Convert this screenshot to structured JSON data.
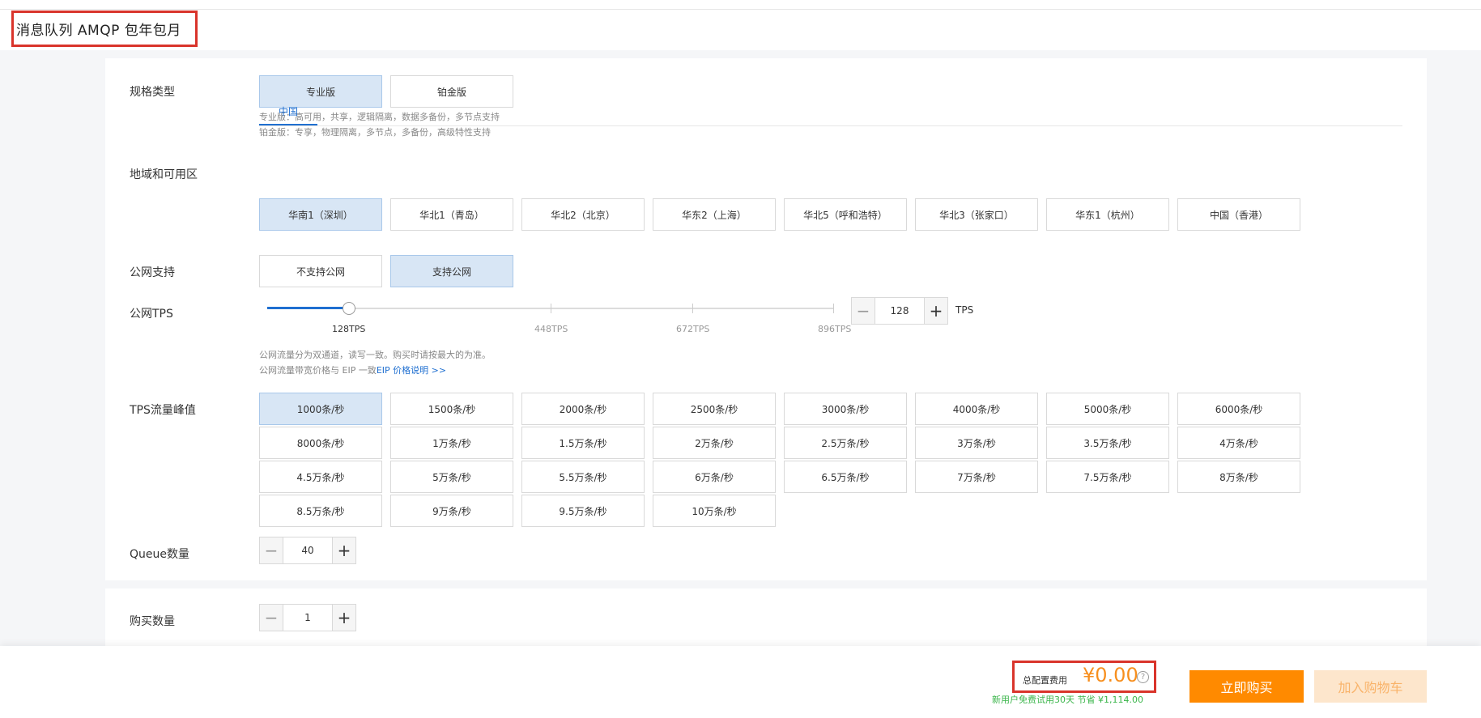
{
  "page_title": "消息队列 AMQP 包年包月",
  "spec": {
    "label": "规格类型",
    "options": [
      "专业版",
      "铂金版"
    ],
    "selected": 0,
    "hint_lines": [
      "专业版：高可用，共享，逻辑隔离，数据多备份，多节点支持",
      "铂金版：专享，物理隔离，多节点，多备份，高级特性支持"
    ]
  },
  "region": {
    "label": "地域和可用区",
    "tab": "中国",
    "options": [
      "华南1（深圳）",
      "华北1（青岛）",
      "华北2（北京）",
      "华东2（上海）",
      "华北5（呼和浩特）",
      "华北3（张家口）",
      "华东1（杭州）",
      "中国（香港）"
    ],
    "selected": 0
  },
  "public_net": {
    "label": "公网支持",
    "options": [
      "不支持公网",
      "支持公网"
    ],
    "selected": 1
  },
  "public_tps": {
    "label": "公网TPS",
    "value": "128",
    "unit": "TPS",
    "marks": [
      "128TPS",
      "448TPS",
      "672TPS",
      "896TPS"
    ],
    "hint_line1": "公网流量分为双通道，读写一致。购买时请按最大的为准。",
    "hint_line2": "公网流量带宽价格与 EIP 一致",
    "hint_link": "EIP 价格说明 >>"
  },
  "tps_peak": {
    "label": "TPS流量峰值",
    "options": [
      "1000条/秒",
      "1500条/秒",
      "2000条/秒",
      "2500条/秒",
      "3000条/秒",
      "4000条/秒",
      "5000条/秒",
      "6000条/秒",
      "8000条/秒",
      "1万条/秒",
      "1.5万条/秒",
      "2万条/秒",
      "2.5万条/秒",
      "3万条/秒",
      "3.5万条/秒",
      "4万条/秒",
      "4.5万条/秒",
      "5万条/秒",
      "5.5万条/秒",
      "6万条/秒",
      "6.5万条/秒",
      "7万条/秒",
      "7.5万条/秒",
      "8万条/秒",
      "8.5万条/秒",
      "9万条/秒",
      "9.5万条/秒",
      "10万条/秒"
    ],
    "selected": 0
  },
  "queue": {
    "label": "Queue数量",
    "value": "40"
  },
  "quantity": {
    "label": "购买数量",
    "value": "1"
  },
  "footer": {
    "price_label": "总配置费用",
    "price": "¥0.00",
    "promo": "新用户免费试用30天 节省 ¥1,114.00",
    "buy_label": "立即购买",
    "cart_label": "加入购物车"
  }
}
